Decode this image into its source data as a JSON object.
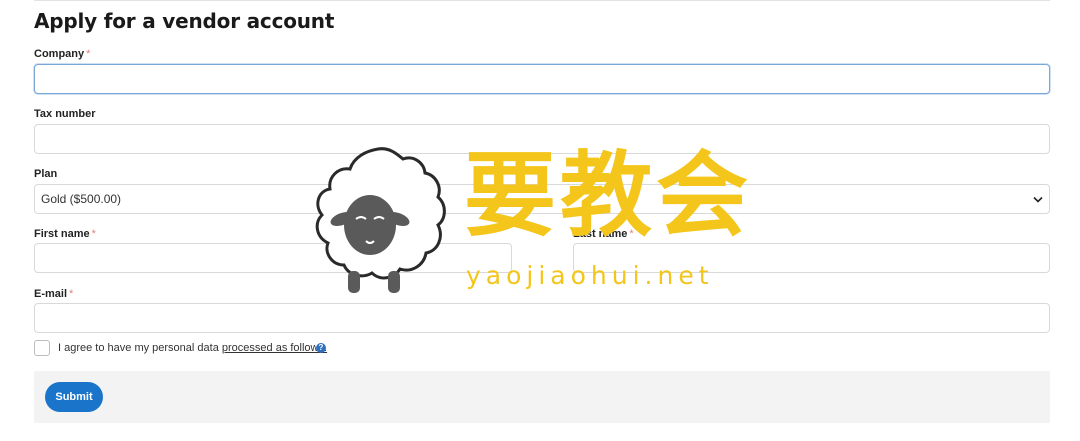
{
  "form": {
    "title": "Apply for a vendor account",
    "company_label": "Company",
    "tax_label": "Tax number",
    "plan_label": "Plan",
    "plan_selected": "Gold ($500.00)",
    "first_name_label": "First name",
    "last_name_label": "Last name",
    "email_label": "E-mail",
    "required_marker": "*",
    "agree_text": "I agree to have my personal data",
    "agree_link": "processed as follows.",
    "info_glyph": "?",
    "submit_label": "Submit"
  },
  "watermark": {
    "cn_text": "要教会",
    "en_text": "yaojiaohui.net"
  },
  "colors": {
    "accent": "#1a74c9",
    "required": "#e08080",
    "watermark": "#f4c51a"
  },
  "icons": {
    "select_chevron": "chevron-down-icon",
    "info": "info-icon",
    "watermark_logo": "sheep-icon"
  }
}
